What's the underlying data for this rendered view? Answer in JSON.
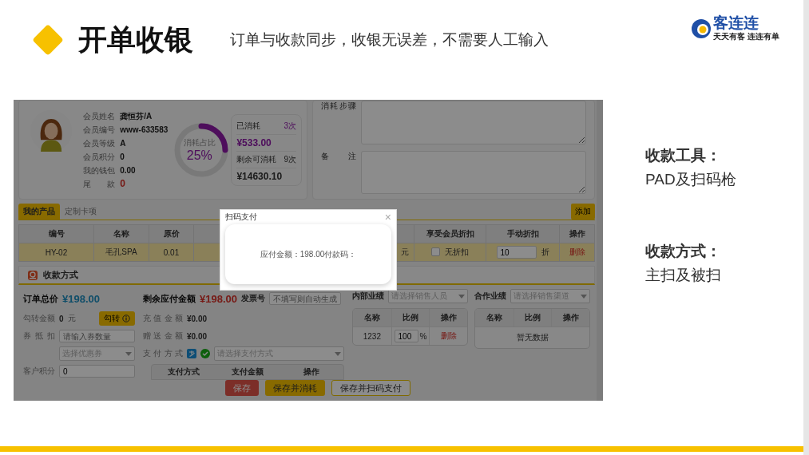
{
  "slide": {
    "title": "开单收银",
    "subtitle": "订单与收款同步，收银无误差，不需要人工输入",
    "logo": {
      "name": "客连连",
      "tagline": "天天有客 连连有单"
    }
  },
  "notes": [
    {
      "heading": "收款工具：",
      "text": "PAD及扫码枪"
    },
    {
      "heading": "收款方式：",
      "text": "主扫及被扫"
    }
  ],
  "app": {
    "member": {
      "fields": [
        {
          "label": "会员姓名",
          "value": "龚恒芬/A",
          "kind": "plain"
        },
        {
          "label": "会员编号",
          "value": "www-633583",
          "kind": "plain"
        },
        {
          "label": "会员等级",
          "value": "A",
          "kind": "plain"
        },
        {
          "label": "会员积分",
          "value": "0",
          "kind": "plain"
        },
        {
          "label": "我的钱包",
          "value": "0.00",
          "kind": "plain"
        },
        {
          "label": "尾款",
          "value": "0",
          "kind": "alert"
        }
      ],
      "ring": {
        "label": "消耗占比",
        "value": "25%",
        "level": 0.25
      },
      "stats": [
        {
          "label": "已消耗",
          "count": "3次",
          "amount": "¥533.00",
          "kind": "used"
        },
        {
          "label": "剩余可消耗",
          "count": "9次",
          "amount": "¥14630.10",
          "kind": "remaining"
        }
      ]
    },
    "form": [
      {
        "label": "消耗步骤"
      },
      {
        "label": "备注"
      }
    ],
    "product_tabs": [
      {
        "label": "我的产品",
        "selected": true
      },
      {
        "label": "定制卡项",
        "selected": false
      }
    ],
    "add_button": "添加",
    "table": {
      "columns": [
        "编号",
        "名称",
        "原价",
        "享受会员折扣",
        "手动折扣",
        "操作"
      ],
      "rows": [
        {
          "code": "HY-02",
          "name": "毛孔SPA",
          "price": "0.01",
          "unit": "元",
          "member_discount": {
            "checked": false,
            "label": "无折扣"
          },
          "manual_discount": "10",
          "discount_unit": "折",
          "action": "删除"
        }
      ]
    },
    "payment": {
      "title": "收款方式",
      "order_total": {
        "label": "订单总价",
        "value": "¥198.00"
      },
      "transfer": {
        "label": "勾转金额",
        "value": "0",
        "unit": "元",
        "button": "勾转"
      },
      "coupon": {
        "label": "券抵扣",
        "placeholder": "请输入券数量",
        "select_placeholder": "选择优惠券"
      },
      "points": {
        "label": "客户积分",
        "value": "0"
      },
      "remaining": {
        "label": "剩余应付金额",
        "value": "¥198.00"
      },
      "invoice": {
        "label": "发票号",
        "placeholder": "不填写则自动生成"
      },
      "recharge": {
        "label": "充值金额",
        "value": "¥0.00"
      },
      "gift": {
        "label": "赠送金额",
        "value": "¥0.00"
      },
      "method": {
        "label": "支付方式",
        "placeholder": "请选择支付方式"
      },
      "method_table": {
        "columns": [
          "支付方式",
          "支付金额",
          "操作"
        ]
      },
      "internal": {
        "label": "内部业绩",
        "placeholder": "请选择销售人员",
        "columns": [
          "名称",
          "比例",
          "操作"
        ],
        "rows": [
          {
            "name": "1232",
            "ratio": "100",
            "unit": "%",
            "action": "删除"
          }
        ]
      },
      "partner": {
        "label": "合作业绩",
        "placeholder": "请选择销售渠道",
        "columns": [
          "名称",
          "比例",
          "操作"
        ],
        "empty": "暂无数据"
      },
      "buttons": [
        {
          "label": "保存",
          "kind": "danger"
        },
        {
          "label": "保存并消耗",
          "kind": "primary"
        },
        {
          "label": "保存并扫码支付",
          "kind": "outline"
        }
      ]
    },
    "modal": {
      "title": "扫码支付",
      "close": "×",
      "message": "应付金额：198.00付款码："
    }
  }
}
